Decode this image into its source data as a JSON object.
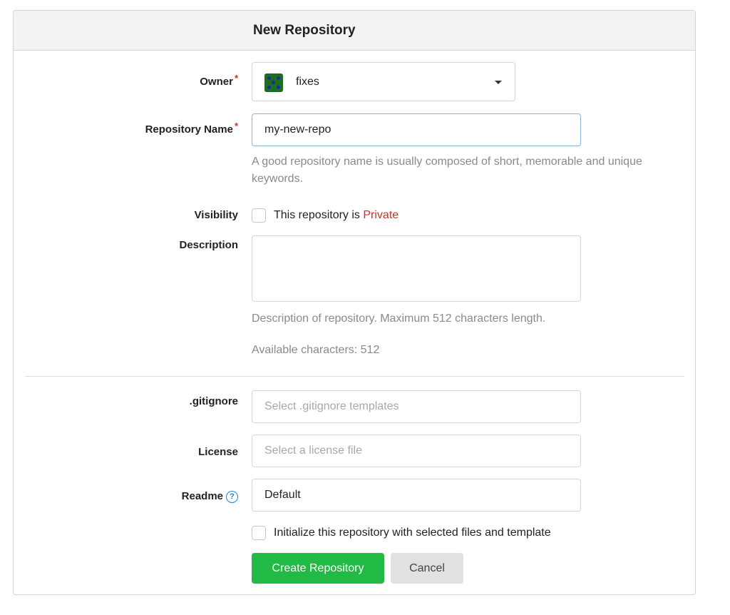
{
  "header": {
    "title": "New Repository"
  },
  "owner": {
    "label": "Owner",
    "required_mark": "*",
    "value": "fixes",
    "avatar_color": "#1b6d1f"
  },
  "repo_name": {
    "label": "Repository Name",
    "required_mark": "*",
    "value": "my-new-repo",
    "help": "A good repository name is usually composed of short, memorable and unique keywords."
  },
  "visibility": {
    "label": "Visibility",
    "checkbox_text": "This repository is ",
    "private_text": "Private",
    "checked": false
  },
  "description": {
    "label": "Description",
    "value": "",
    "help": "Description of repository. Maximum 512 characters length.",
    "available": "Available characters: 512"
  },
  "gitignore": {
    "label": ".gitignore",
    "placeholder": "Select .gitignore templates"
  },
  "license": {
    "label": "License",
    "placeholder": "Select a license file"
  },
  "readme": {
    "label": "Readme",
    "help_icon": "?",
    "value": "Default"
  },
  "init": {
    "text": "Initialize this repository with selected files and template",
    "checked": false
  },
  "buttons": {
    "create": "Create Repository",
    "cancel": "Cancel"
  },
  "colors": {
    "primary_green": "#21ba45",
    "danger_red": "#db2828",
    "focus_blue": "#85b7d9",
    "info_blue": "#2185d0"
  }
}
